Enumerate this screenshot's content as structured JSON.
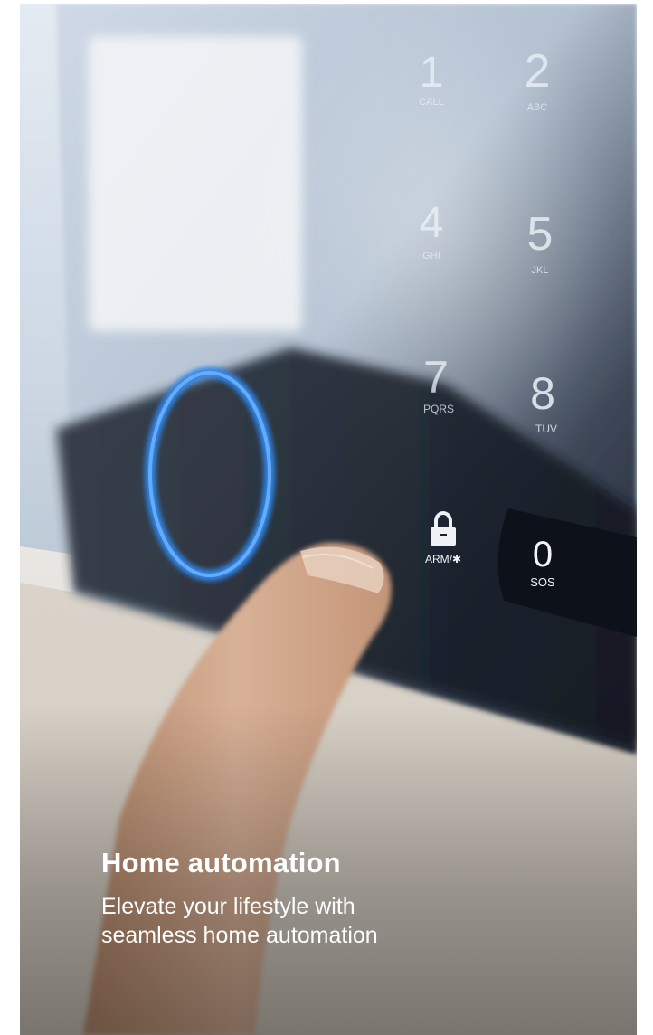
{
  "keypad": {
    "keys": [
      {
        "digit": "1",
        "letters": "CALL"
      },
      {
        "digit": "2",
        "letters": "ABC"
      },
      {
        "digit": "4",
        "letters": "GHI"
      },
      {
        "digit": "5",
        "letters": "JKL"
      },
      {
        "digit": "7",
        "letters": "PQRS"
      },
      {
        "digit": "8",
        "letters": "TUV"
      },
      {
        "digit": "0",
        "letters": "SOS"
      }
    ],
    "arm_label": "ARM/✱"
  },
  "card": {
    "title": "Home automation",
    "subtitle_line1": "Elevate your lifestyle with",
    "subtitle_line2": "seamless home automation"
  },
  "colors": {
    "ring_blue": "#2f86e8",
    "text": "#ffffff"
  }
}
